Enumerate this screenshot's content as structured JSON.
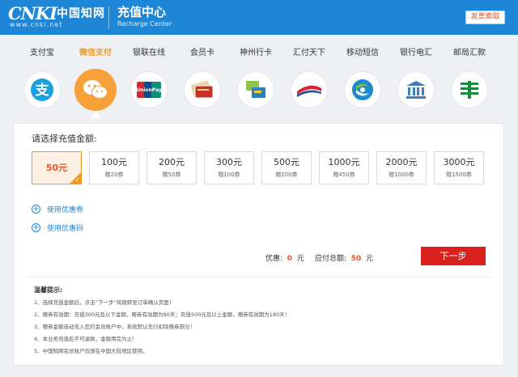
{
  "header": {
    "logo_text": "CNKI",
    "logo_cn": "中国知网",
    "logo_url": "www.cnki.net",
    "title": "充值中心",
    "subtitle": "Recharge Center",
    "button_label": "发票索取"
  },
  "payment_methods": [
    {
      "label": "支付宝",
      "icon": "alipay-icon",
      "active": false
    },
    {
      "label": "微信支付",
      "icon": "wechat-icon",
      "active": true
    },
    {
      "label": "银联在线",
      "icon": "unionpay-icon",
      "active": false
    },
    {
      "label": "会员卡",
      "icon": "member-card-icon",
      "active": false
    },
    {
      "label": "神州行卡",
      "icon": "shenzhouxing-card-icon",
      "active": false
    },
    {
      "label": "汇付天下",
      "icon": "chinapnr-icon",
      "active": false
    },
    {
      "label": "移动短信",
      "icon": "china-mobile-icon",
      "active": false
    },
    {
      "label": "银行电汇",
      "icon": "bank-icon",
      "active": false
    },
    {
      "label": "邮局汇款",
      "icon": "post-office-icon",
      "active": false
    }
  ],
  "recharge": {
    "label": "请选择充值金额:",
    "amounts": [
      {
        "value": "50元",
        "bonus": "",
        "selected": true
      },
      {
        "value": "100元",
        "bonus": "赠20券",
        "selected": false
      },
      {
        "value": "200元",
        "bonus": "赠50券",
        "selected": false
      },
      {
        "value": "300元",
        "bonus": "赠100券",
        "selected": false
      },
      {
        "value": "500元",
        "bonus": "赠200券",
        "selected": false
      },
      {
        "value": "1000元",
        "bonus": "赠450券",
        "selected": false
      },
      {
        "value": "2000元",
        "bonus": "赠1000券",
        "selected": false
      },
      {
        "value": "3000元",
        "bonus": "赠1500券",
        "selected": false
      }
    ],
    "use_coupon": "使用优惠券",
    "use_code": "使用优惠码"
  },
  "summary": {
    "discount_label": "优惠:",
    "discount_value": "0",
    "discount_unit": "元",
    "total_label": "应付总额:",
    "total_value": "50",
    "total_unit": "元",
    "next_button": "下一步"
  },
  "tips": {
    "title": "温馨提示:",
    "items": [
      "1、选择充值金额后，点击“下一步”将跳转至订单确认页面！",
      "2、赠券有效期：充值300元及以下金额，赠券有效期为90天；充值500元及以上金额，赠券有效期为180天！",
      "3、赠券金额自动充入您的会员账户中，系统默认先行扣除赠券部分！",
      "4、本业务充值后不可退款，金额用完为止！",
      "5、中国知网会员账户仅限在中国大陆地区使用。"
    ]
  },
  "colors": {
    "header_bg": "#1e86d6",
    "accent_orange": "#f39a1d",
    "next_button_red": "#d9201d"
  }
}
